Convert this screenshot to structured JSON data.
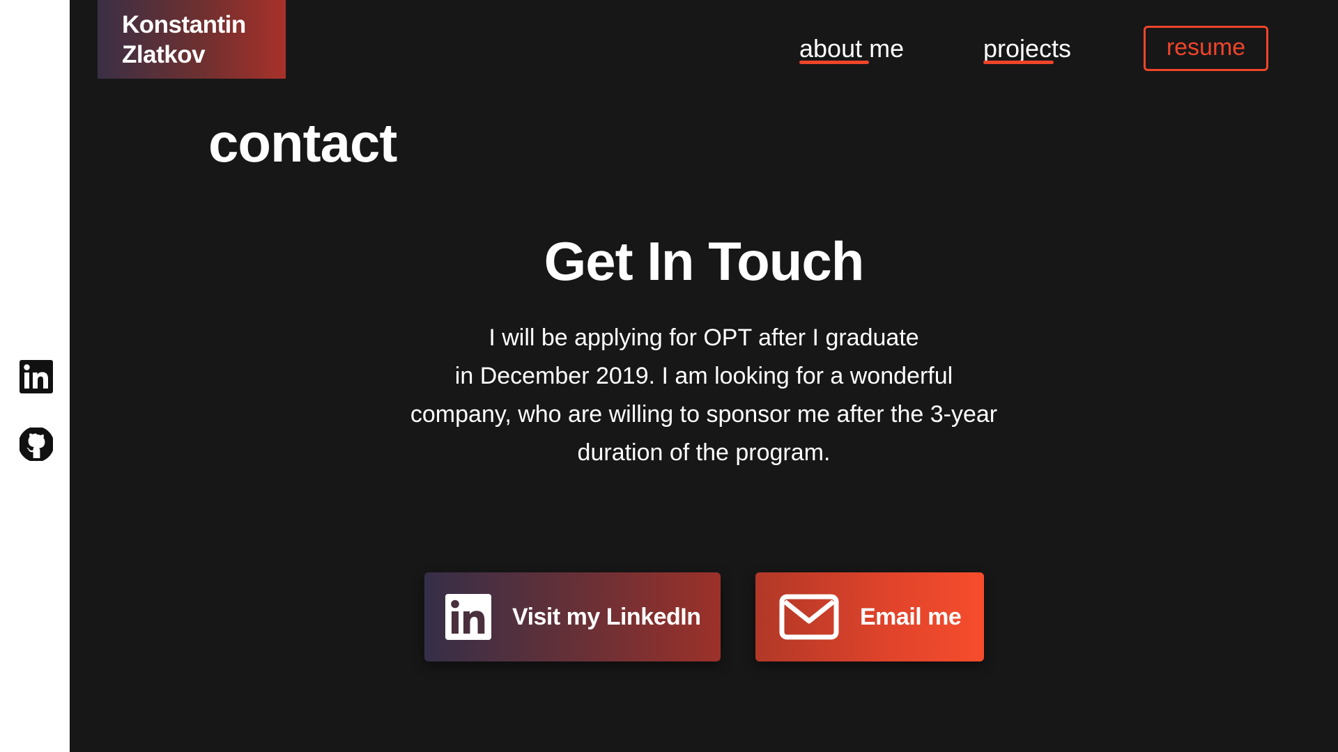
{
  "logo": {
    "line1": "Konstantin",
    "line2": "Zlatkov"
  },
  "nav": {
    "about_label": "about me",
    "projects_label": "projects",
    "resume_label": "resume"
  },
  "section": {
    "title": "contact"
  },
  "contact": {
    "headline": "Get In Touch",
    "blurb_lines": [
      "I will be applying for OPT after I graduate",
      "in December 2019. I am looking for a wonderful",
      "company, who are willing to sponsor me after the 3-year",
      "duration of the program."
    ],
    "linkedin_button_label": "Visit my LinkedIn",
    "email_button_label": "Email me"
  },
  "social": {
    "icons": [
      "linkedin-icon",
      "github-icon"
    ]
  },
  "colors": {
    "background": "#171718",
    "accent": "#f0452a",
    "rail": "#ffffff"
  }
}
